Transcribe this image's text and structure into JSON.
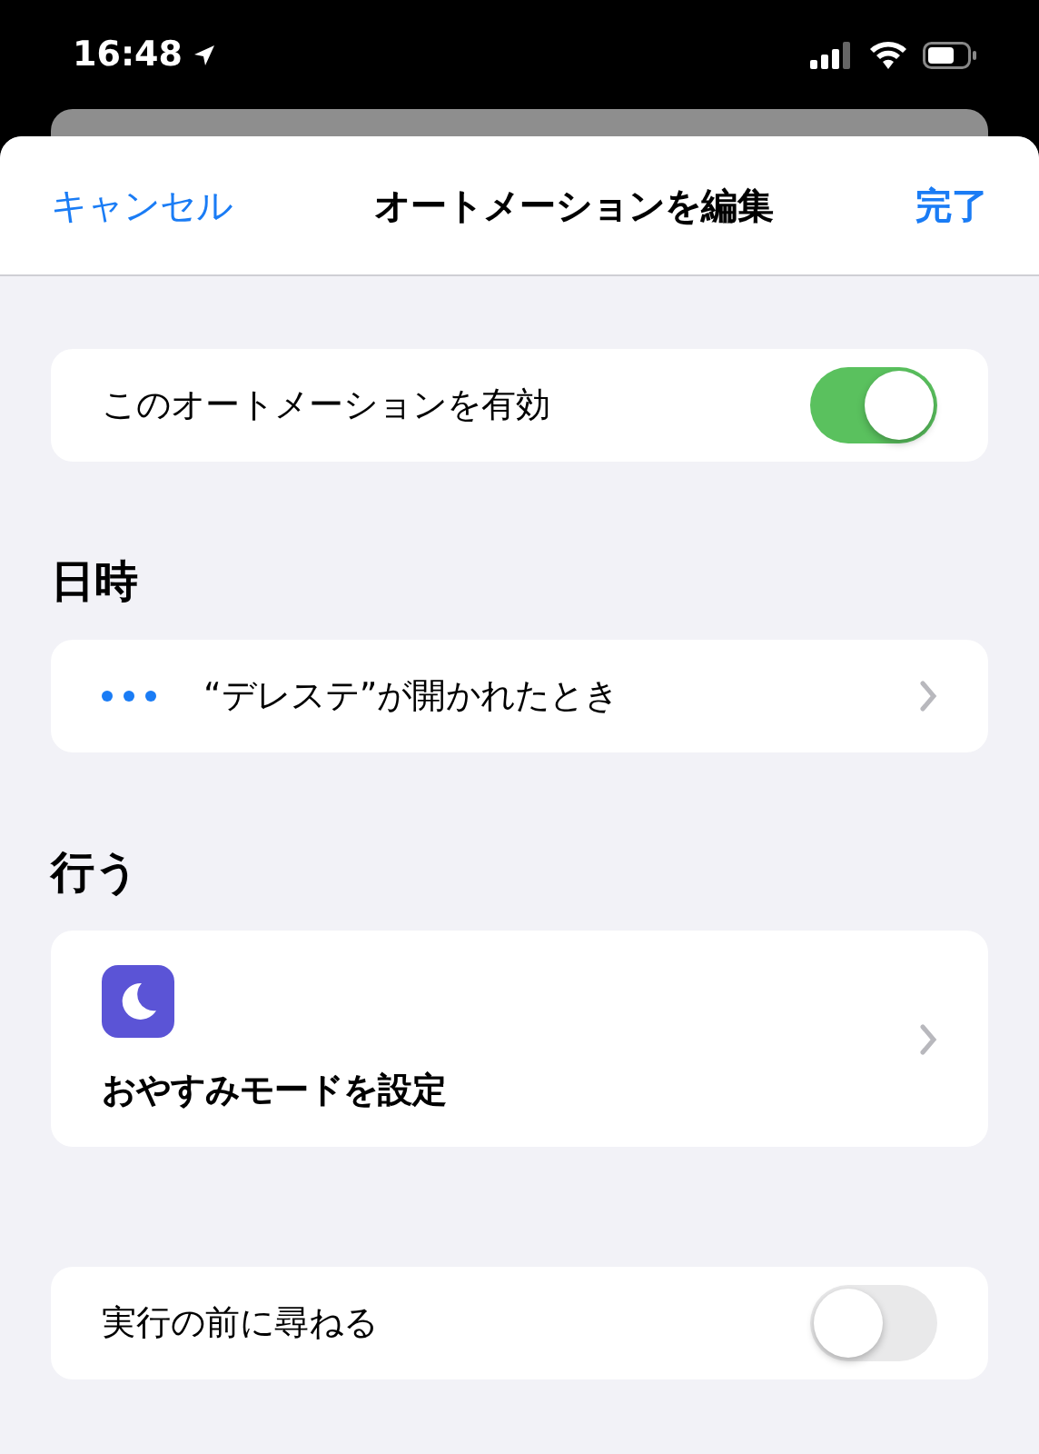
{
  "status_bar": {
    "time": "16:48"
  },
  "nav": {
    "cancel": "キャンセル",
    "title": "オートメーションを編集",
    "done": "完了"
  },
  "enable": {
    "label": "このオートメーションを有効",
    "on": true
  },
  "sections": [
    {
      "title": "日時",
      "items": [
        {
          "kind": "trigger",
          "label": "“デレステ”が開かれたとき"
        }
      ]
    },
    {
      "title": "行う",
      "items": [
        {
          "kind": "action",
          "label": "おやすみモードを設定"
        }
      ]
    }
  ],
  "ask": {
    "label": "実行の前に尋ねる",
    "on": false
  }
}
